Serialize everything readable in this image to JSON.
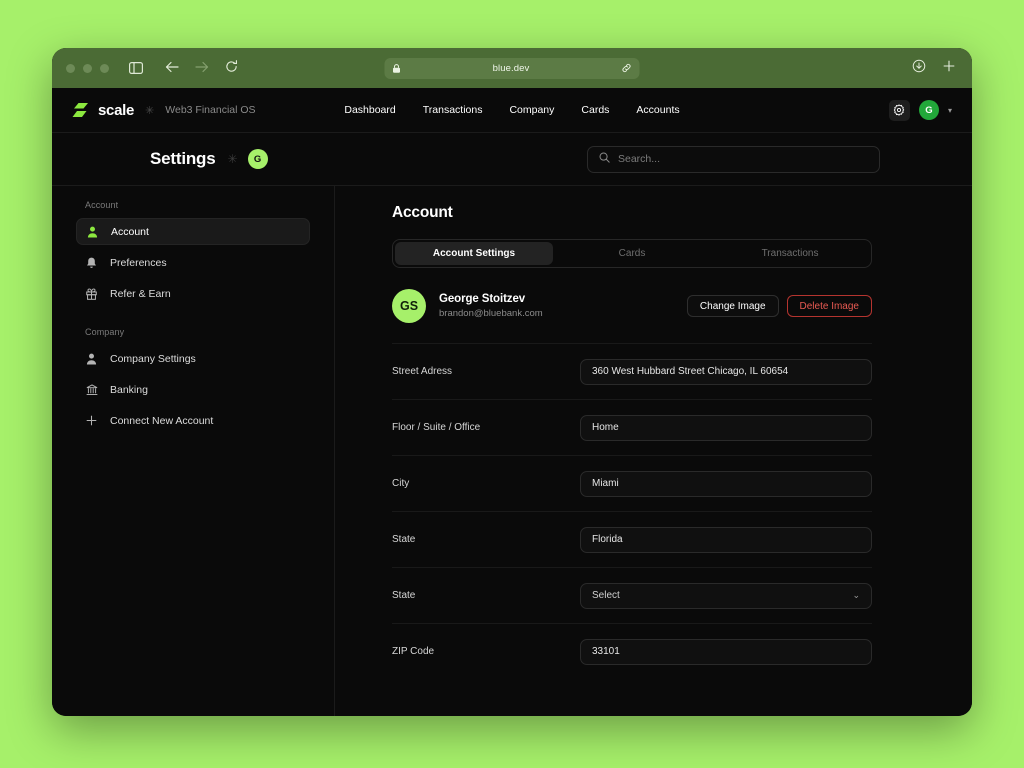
{
  "browser": {
    "url": "blue.dev",
    "icons": {
      "lock": "lock-icon",
      "link": "link-icon",
      "sidebar_toggle": "sidebar-toggle-icon",
      "back": "back-arrow-icon",
      "forward": "forward-arrow-icon",
      "reload": "reload-icon",
      "download": "download-icon",
      "new_tab": "plus-icon"
    }
  },
  "topnav": {
    "brand": "scale",
    "separator": "✳",
    "tagline": "Web3 Financial OS",
    "links": [
      {
        "label": "Dashboard"
      },
      {
        "label": "Transactions"
      },
      {
        "label": "Company"
      },
      {
        "label": "Cards"
      },
      {
        "label": "Accounts"
      }
    ],
    "avatar_initial": "G"
  },
  "settings_header": {
    "title": "Settings",
    "separator": "✳",
    "avatar_initial": "G"
  },
  "search": {
    "placeholder": "Search..."
  },
  "sidebar": {
    "groups": [
      {
        "label": "Account",
        "items": [
          {
            "label": "Account",
            "icon": "person-icon",
            "active": true
          },
          {
            "label": "Preferences",
            "icon": "bell-icon",
            "active": false
          },
          {
            "label": "Refer & Earn",
            "icon": "gift-icon",
            "active": false
          }
        ]
      },
      {
        "label": "Company",
        "items": [
          {
            "label": "Company Settings",
            "icon": "person-icon",
            "active": false
          },
          {
            "label": "Banking",
            "icon": "bank-icon",
            "active": false
          },
          {
            "label": "Connect New Account",
            "icon": "plus-icon",
            "active": false
          }
        ]
      }
    ]
  },
  "main": {
    "title": "Account",
    "tabs": [
      {
        "label": "Account Settings",
        "active": true
      },
      {
        "label": "Cards",
        "active": false
      },
      {
        "label": "Transactions",
        "active": false
      }
    ],
    "profile": {
      "initials": "GS",
      "name": "George Stoitzev",
      "email": "brandon@bluebank.com",
      "change_label": "Change Image",
      "delete_label": "Delete Image"
    },
    "fields": [
      {
        "label": "Street Adress",
        "value": "360 West Hubbard Street Chicago, IL 60654",
        "type": "text"
      },
      {
        "label": "Floor / Suite / Office",
        "value": "Home",
        "type": "text"
      },
      {
        "label": "City",
        "value": "Miami",
        "type": "text"
      },
      {
        "label": "State",
        "value": "Florida",
        "type": "text"
      },
      {
        "label": "State",
        "value": "Select",
        "type": "select"
      },
      {
        "label": "ZIP Code",
        "value": "33101",
        "type": "text"
      }
    ]
  },
  "colors": {
    "page_background": "#a6f06a",
    "titlebar": "#4b6b35",
    "app_background": "#0a0a0a",
    "accent_lime": "#a6f06a",
    "accent_green": "#22a83a",
    "danger": "#e85a52"
  }
}
